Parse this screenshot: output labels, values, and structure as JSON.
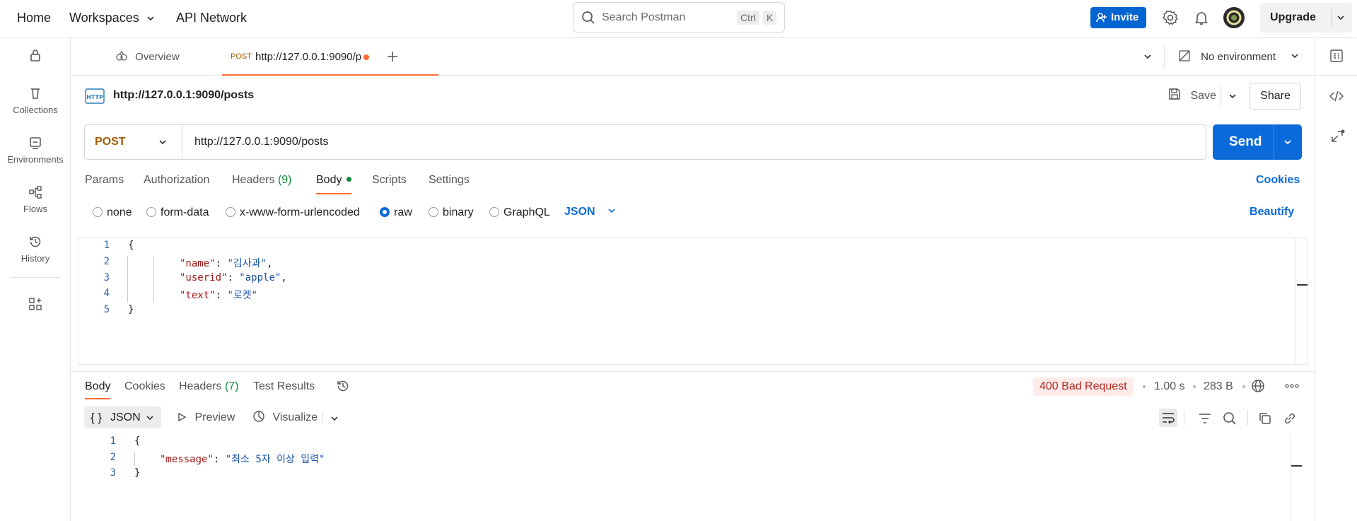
{
  "topbar": {
    "home": "Home",
    "workspaces": "Workspaces",
    "api_network": "API Network",
    "search_placeholder": "Search Postman",
    "kbd_ctrl": "Ctrl",
    "kbd_k": "K",
    "invite": "Invite",
    "upgrade": "Upgrade"
  },
  "sidebar": {
    "items": [
      {
        "label": "Collections"
      },
      {
        "label": "Environments"
      },
      {
        "label": "Flows"
      },
      {
        "label": "History"
      }
    ]
  },
  "tabs": {
    "overview": "Overview",
    "active_method": "POST",
    "active_url": "http://127.0.0.1:9090/p",
    "environment": "No environment"
  },
  "request": {
    "title": "http://127.0.0.1:9090/posts",
    "save": "Save",
    "share": "Share",
    "method": "POST",
    "url": "http://127.0.0.1:9090/posts",
    "send": "Send",
    "tabs": {
      "params": "Params",
      "authorization": "Authorization",
      "headers": "Headers",
      "headers_count": "(9)",
      "body": "Body",
      "scripts": "Scripts",
      "settings": "Settings",
      "cookies": "Cookies"
    },
    "body_types": {
      "none": "none",
      "form_data": "form-data",
      "urlencoded": "x-www-form-urlencoded",
      "raw": "raw",
      "binary": "binary",
      "graphql": "GraphQL",
      "format": "JSON",
      "beautify": "Beautify"
    },
    "body_lines": [
      {
        "n": "1",
        "text": "{"
      },
      {
        "n": "2",
        "key": "\"name\"",
        "value": "\"김사과\"",
        "tail": ","
      },
      {
        "n": "3",
        "key": "\"userid\"",
        "value": "\"apple\"",
        "tail": ","
      },
      {
        "n": "4",
        "key": "\"text\"",
        "value": "\"로켓\"",
        "tail": ""
      },
      {
        "n": "5",
        "text": "}"
      }
    ]
  },
  "response": {
    "tabs": {
      "body": "Body",
      "cookies": "Cookies",
      "headers": "Headers",
      "headers_count": "(7)",
      "test_results": "Test Results"
    },
    "status": "400 Bad Request",
    "time": "1.00 s",
    "size": "283 B",
    "format": "JSON",
    "format_glyph": "{ }",
    "preview": "Preview",
    "visualize": "Visualize",
    "body_lines": [
      {
        "n": "1",
        "text": "{"
      },
      {
        "n": "2",
        "key": "\"message\"",
        "value": "\"최소 5자 이상 입력\""
      },
      {
        "n": "3",
        "text": "}"
      }
    ]
  },
  "colors": {
    "accent_orange": "#ff6c37",
    "send_blue": "#0b6ad9",
    "error_red": "#b3261e"
  }
}
